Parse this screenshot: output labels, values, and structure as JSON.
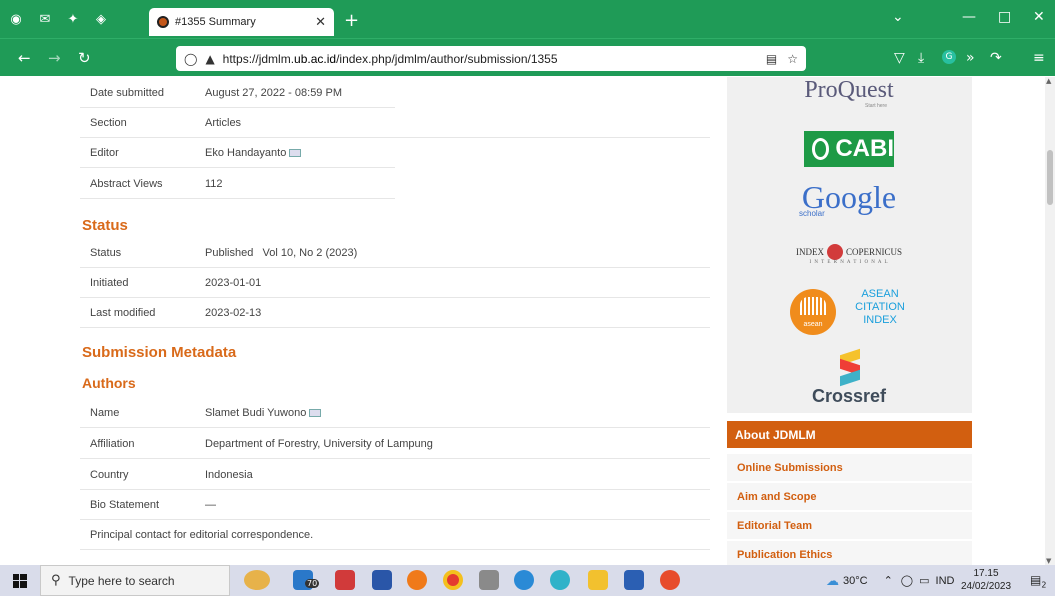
{
  "browser": {
    "tab_title": "#1355 Summary",
    "url_prefix": "https://jdmlm.",
    "url_host": "ub.ac.id",
    "url_path": "/index.php/jdmlm/author/submission/1355"
  },
  "submission": {
    "rows": [
      {
        "label": "Date submitted",
        "value": "August 27, 2022 - 08:59 PM"
      },
      {
        "label": "Section",
        "value": "Articles"
      },
      {
        "label": "Editor",
        "value": "Eko Handayanto"
      },
      {
        "label": "Abstract Views",
        "value": "112"
      }
    ]
  },
  "status": {
    "heading": "Status",
    "rows": [
      {
        "label": "Status",
        "value": "Published   Vol 10, No 2 (2023)"
      },
      {
        "label": "Initiated",
        "value": "2023-01-01"
      },
      {
        "label": "Last modified",
        "value": "2023-02-13"
      }
    ]
  },
  "metadata": {
    "heading": "Submission Metadata",
    "authors_heading": "Authors",
    "rows": [
      {
        "label": "Name",
        "value": "Slamet Budi Yuwono"
      },
      {
        "label": "Affiliation",
        "value": "Department of Forestry, University of Lampung"
      },
      {
        "label": "Country",
        "value": "Indonesia"
      },
      {
        "label": "Bio Statement",
        "value": "—"
      }
    ],
    "note": "Principal contact for editorial correspondence."
  },
  "sidebar": {
    "logos": {
      "proquest": "ProQuest",
      "proquest_sub": "Start here",
      "cabi": "CABI",
      "google": "Google",
      "google_sub": "scholar",
      "index_left": "INDEX",
      "index_right": "COPERNICUS",
      "index_sub": "I N T E R N A T I O N A L",
      "asean_1": "ASEAN",
      "asean_2": "CITATION",
      "asean_3": "INDEX",
      "asean_circle": "asean",
      "crossref": "Crossref"
    },
    "about_heading": "About JDMLM",
    "links": [
      "Online Submissions",
      "Aim and Scope",
      "Editorial Team",
      "Publication Ethics"
    ]
  },
  "taskbar": {
    "search_placeholder": "Type here to search",
    "badge": "70",
    "weather": "30°C",
    "lang": "IND",
    "time": "17.15",
    "date": "24/02/2023",
    "notif_count": "2"
  }
}
